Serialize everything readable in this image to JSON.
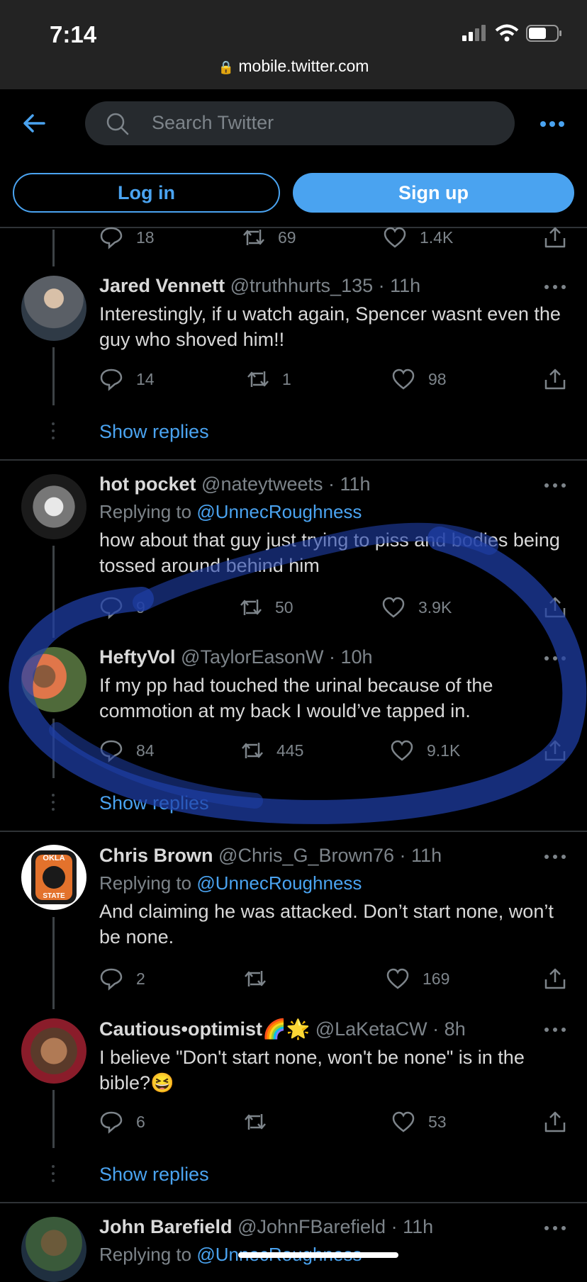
{
  "status_bar": {
    "time": "7:14",
    "url": "mobile.twitter.com"
  },
  "header": {
    "search_placeholder": "Search Twitter",
    "login_label": "Log in",
    "signup_label": "Sign up"
  },
  "top_actions": {
    "replies": "18",
    "retweets": "69",
    "likes": "1.4K"
  },
  "tweets": [
    {
      "name": "Jared Vennett",
      "handle": "@truthhurts_135",
      "time": "11h",
      "replying_prefix": "",
      "replying_to": "",
      "text": "Interestingly, if u watch again, Spencer wasnt even the guy who shoved him!!",
      "replies": "14",
      "retweets": "1",
      "likes": "98"
    },
    {
      "name": "hot pocket",
      "handle": "@nateytweets",
      "time": "11h",
      "replying_prefix": "Replying to",
      "replying_to": "@UnnecRoughness",
      "text": "how about that guy just trying to piss and bodies being tossed around behind him",
      "replies": "9",
      "retweets": "50",
      "likes": "3.9K"
    },
    {
      "name": "HeftyVol",
      "handle": "@TaylorEasonW",
      "time": "10h",
      "replying_prefix": "",
      "replying_to": "",
      "text": "If my pp had touched the urinal because of the commotion at my back I would’ve tapped in.",
      "replies": "84",
      "retweets": "445",
      "likes": "9.1K"
    },
    {
      "name": "Chris Brown",
      "handle": "@Chris_G_Brown76",
      "time": "11h",
      "replying_prefix": "Replying to",
      "replying_to": "@UnnecRoughness",
      "text": "And claiming he was attacked.  Don’t start none, won’t be none.",
      "replies": "2",
      "retweets": "",
      "likes": "169"
    },
    {
      "name": "Cautious•optimist🌈🌟",
      "handle": "@LaKetaCW",
      "time": "8h",
      "replying_prefix": "",
      "replying_to": "",
      "text": "I believe \"Don't start none, won't be none\" is in the bible?😆",
      "replies": "6",
      "retweets": "",
      "likes": "53"
    },
    {
      "name": "John Barefield",
      "handle": "@JohnFBarefield",
      "time": "11h",
      "replying_prefix": "Replying to",
      "replying_to": "@UnnecRoughness",
      "text": "",
      "replies": "",
      "retweets": "",
      "likes": ""
    }
  ],
  "show_replies_label": "Show replies",
  "avatar_texts": {
    "okla": "OKLA",
    "state": "STATE"
  },
  "colors": {
    "accent": "#4aa3f0",
    "background": "#000000",
    "scribble": "#1f3fa8"
  }
}
